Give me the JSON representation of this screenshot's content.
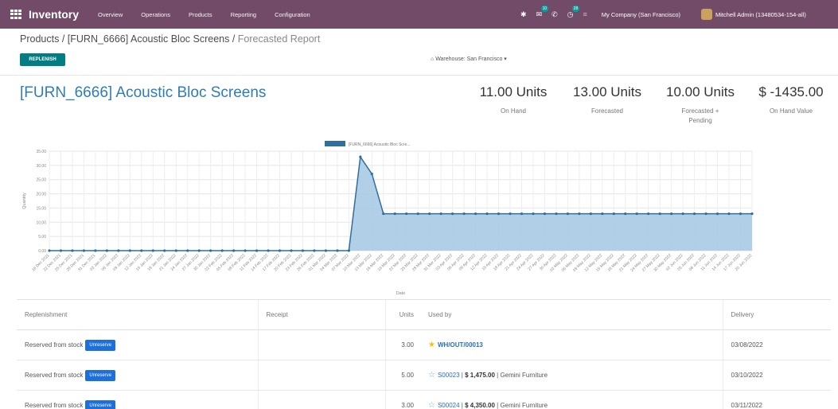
{
  "navbar": {
    "app_title": "Inventory",
    "menu": [
      "Overview",
      "Operations",
      "Products",
      "Reporting",
      "Configuration"
    ],
    "messages_count": "10",
    "activities_count": "28",
    "company": "My Company (San Francisco)",
    "user": "Mitchell Admin (13480534-154-all)"
  },
  "breadcrumb": {
    "products": "Products",
    "product": "[FURN_6666] Acoustic Bloc Screens",
    "current": "Forecasted Report"
  },
  "toolbar": {
    "replenish_label": "REPLENISH",
    "warehouse_label": "Warehouse: San Francisco"
  },
  "product": {
    "title": "[FURN_6666] Acoustic Bloc Screens",
    "on_hand_value": "11.00 Units",
    "on_hand_label": "On Hand",
    "forecasted_value": "13.00 Units",
    "forecasted_label": "Forecasted",
    "forecasted_pending_value": "10.00 Units",
    "forecasted_pending_label": "Forecasted + Pending",
    "on_hand_value_money": "$ -1435.00",
    "on_hand_value_money_label": "On Hand Value"
  },
  "chart_data": {
    "type": "area",
    "legend": "[FURN_6666] Acoustic Bloc Scre...",
    "xlabel": "Date",
    "ylabel": "Quantity",
    "ylim": [
      0,
      35
    ],
    "yticks": [
      "0.00",
      "5.00",
      "10.00",
      "15.00",
      "20.00",
      "25.00",
      "30.00",
      "35.00"
    ],
    "x": [
      "19 Dec 2021",
      "22 Dec 2021",
      "25 Dec 2021",
      "28 Dec 2021",
      "31 Dec 2021",
      "03 Jan 2022",
      "06 Jan 2022",
      "09 Jan 2022",
      "12 Jan 2022",
      "15 Jan 2022",
      "18 Jan 2022",
      "21 Jan 2022",
      "24 Jan 2022",
      "27 Jan 2022",
      "30 Jan 2022",
      "02 Feb 2022",
      "05 Feb 2022",
      "08 Feb 2022",
      "11 Feb 2022",
      "14 Feb 2022",
      "17 Feb 2022",
      "20 Feb 2022",
      "23 Feb 2022",
      "26 Feb 2022",
      "01 Mar 2022",
      "04 Mar 2022",
      "07 Mar 2022",
      "10 Mar 2022",
      "13 Mar 2022",
      "16 Mar 2022",
      "19 Mar 2022",
      "22 Mar 2022",
      "25 Mar 2022",
      "28 Mar 2022",
      "31 Mar 2022",
      "03 Apr 2022",
      "06 Apr 2022",
      "09 Apr 2022",
      "12 Apr 2022",
      "15 Apr 2022",
      "18 Apr 2022",
      "21 Apr 2022",
      "24 Apr 2022",
      "27 Apr 2022",
      "30 Apr 2022",
      "03 May 2022",
      "06 May 2022",
      "09 May 2022",
      "12 May 2022",
      "15 May 2022",
      "18 May 2022",
      "21 May 2022",
      "24 May 2022",
      "27 May 2022",
      "30 May 2022",
      "02 Jun 2022",
      "05 Jun 2022",
      "08 Jun 2022",
      "11 Jun 2022",
      "14 Jun 2022",
      "17 Jun 2022",
      "20 Jun 2022"
    ],
    "series": [
      {
        "name": "[FURN_6666] Acoustic Bloc Scre...",
        "values": [
          0,
          0,
          0,
          0,
          0,
          0,
          0,
          0,
          0,
          0,
          0,
          0,
          0,
          0,
          0,
          0,
          0,
          0,
          0,
          0,
          0,
          0,
          0,
          0,
          0,
          0,
          0,
          33,
          27,
          13,
          13,
          13,
          13,
          13,
          13,
          13,
          13,
          13,
          13,
          13,
          13,
          13,
          13,
          13,
          13,
          13,
          13,
          13,
          13,
          13,
          13,
          13,
          13,
          13,
          13,
          13,
          13,
          13,
          13,
          13,
          13,
          13
        ]
      }
    ],
    "grid": true,
    "legend_position": "top"
  },
  "table": {
    "headers": [
      "Replenishment",
      "Receipt",
      "Units",
      "Used by",
      "Delivery"
    ],
    "rows": [
      {
        "replenishment": "Reserved from stock",
        "action": "Unreserve",
        "receipt": "",
        "units": "3.00",
        "starred": true,
        "ref": "WH/OUT/00013",
        "amount": "",
        "partner": "",
        "delivery": "03/08/2022"
      },
      {
        "replenishment": "Reserved from stock",
        "action": "Unreserve",
        "receipt": "",
        "units": "5.00",
        "starred": false,
        "ref": "S00023",
        "amount": "$ 1,475.00",
        "partner": "Gemini Furniture",
        "delivery": "03/10/2022"
      },
      {
        "replenishment": "Reserved from stock",
        "action": "Unreserve",
        "receipt": "",
        "units": "3.00",
        "starred": false,
        "ref": "S00024",
        "amount": "$ 4,350.00",
        "partner": "Gemini Furniture",
        "delivery": "03/11/2022"
      }
    ]
  },
  "colors": {
    "navbar": "#714b67",
    "primary": "#017e84",
    "link": "#2f7cb6",
    "chart_line": "#2e6f9e",
    "chart_fill": "#a8cbe6",
    "unreserve_button": "#1d6fdb"
  }
}
